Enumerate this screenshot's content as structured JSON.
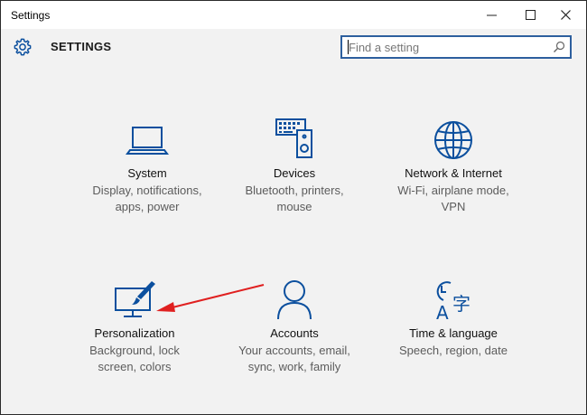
{
  "window": {
    "title": "Settings",
    "minimize_glyph": "minimize-icon",
    "maximize_glyph": "maximize-icon",
    "close_glyph": "close-icon"
  },
  "header": {
    "icon": "gear-icon",
    "title": "SETTINGS",
    "search": {
      "placeholder": "Find a setting",
      "icon": "search-icon"
    }
  },
  "colors": {
    "accent": "#0b4f9e",
    "focus_border": "#2d5f9e",
    "arrow": "#e02020",
    "background": "#f2f2f2"
  },
  "categories": [
    {
      "id": "system",
      "name": "System",
      "desc1": "Display, notifications,",
      "desc2": "apps, power",
      "icon": "laptop-icon"
    },
    {
      "id": "devices",
      "name": "Devices",
      "desc1": "Bluetooth, printers,",
      "desc2": "mouse",
      "icon": "keyboard-speaker-icon"
    },
    {
      "id": "network",
      "name": "Network & Internet",
      "desc1": "Wi-Fi, airplane mode,",
      "desc2": "VPN",
      "icon": "globe-icon"
    },
    {
      "id": "personalization",
      "name": "Personalization",
      "desc1": "Background, lock",
      "desc2": "screen, colors",
      "icon": "monitor-brush-icon"
    },
    {
      "id": "accounts",
      "name": "Accounts",
      "desc1": "Your accounts, email,",
      "desc2": "sync, work, family",
      "icon": "person-icon"
    },
    {
      "id": "time",
      "name": "Time & language",
      "desc1": "Speech, region, date",
      "desc2": "",
      "icon": "clock-language-icon"
    }
  ],
  "annotation": {
    "icon": "red-arrow-icon",
    "points_to": "personalization"
  }
}
